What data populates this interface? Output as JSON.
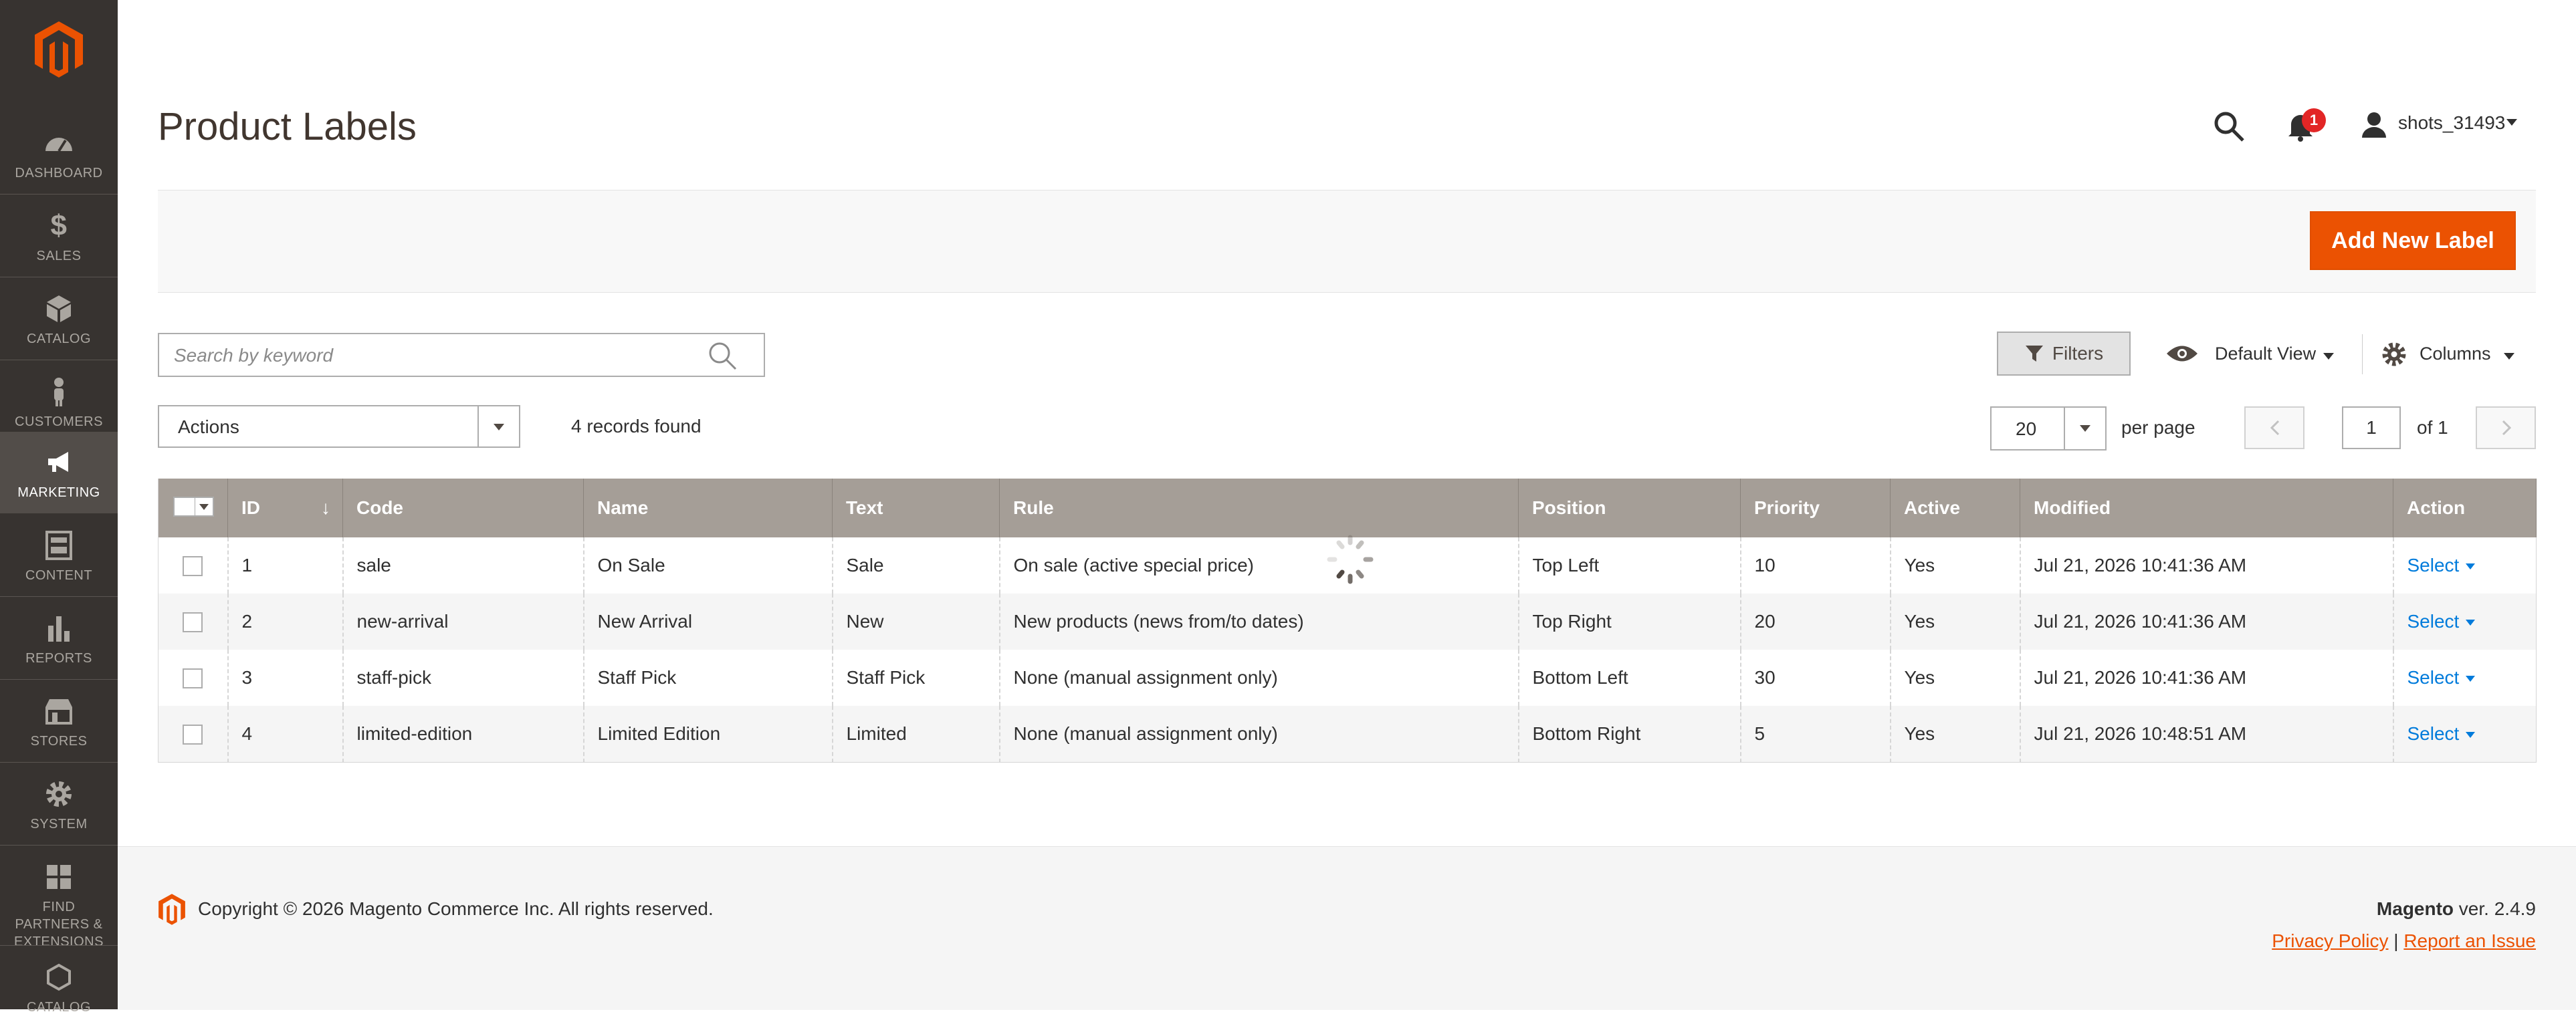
{
  "sidebar": {
    "items": [
      {
        "label": "DASHBOARD",
        "icon": "dashboard-icon"
      },
      {
        "label": "SALES",
        "icon": "dollar-icon"
      },
      {
        "label": "CATALOG",
        "icon": "cube-icon"
      },
      {
        "label": "CUSTOMERS",
        "icon": "person-icon"
      },
      {
        "label": "MARKETING",
        "icon": "megaphone-icon"
      },
      {
        "label": "CONTENT",
        "icon": "layout-icon"
      },
      {
        "label": "REPORTS",
        "icon": "bar-chart-icon"
      },
      {
        "label": "STORES",
        "icon": "store-icon"
      },
      {
        "label": "SYSTEM",
        "icon": "gear-icon"
      },
      {
        "label": "FIND PARTNERS & EXTENSIONS",
        "icon": "boxes-icon"
      },
      {
        "label": "CATALOG",
        "icon": "hexagon-icon"
      }
    ],
    "active": "MARKETING"
  },
  "header": {
    "title": "Product Labels",
    "notifications_count": "1",
    "username": "shots_31493"
  },
  "actionbar": {
    "add_label": "Add New Label"
  },
  "toolbar": {
    "search_placeholder": "Search by keyword",
    "filters_label": "Filters",
    "view_label": "Default View",
    "columns_label": "Columns",
    "actions_label": "Actions",
    "records_found": "4 records found",
    "per_page_value": "20",
    "per_page_label": "per page",
    "current_page": "1",
    "of_pages": "of 1"
  },
  "table": {
    "headers": {
      "id": "ID",
      "code": "Code",
      "name": "Name",
      "text": "Text",
      "rule": "Rule",
      "position": "Position",
      "priority": "Priority",
      "active": "Active",
      "modified": "Modified",
      "action": "Action"
    },
    "rows": [
      {
        "id": "1",
        "code": "sale",
        "name": "On Sale",
        "text": "Sale",
        "rule": "On sale (active special price)",
        "position": "Top Left",
        "priority": "10",
        "active": "Yes",
        "modified": "Jul 21, 2026 10:41:36 AM",
        "action": "Select"
      },
      {
        "id": "2",
        "code": "new-arrival",
        "name": "New Arrival",
        "text": "New",
        "rule": "New products (news from/to dates)",
        "position": "Top Right",
        "priority": "20",
        "active": "Yes",
        "modified": "Jul 21, 2026 10:41:36 AM",
        "action": "Select"
      },
      {
        "id": "3",
        "code": "staff-pick",
        "name": "Staff Pick",
        "text": "Staff Pick",
        "rule": "None (manual assignment only)",
        "position": "Bottom Left",
        "priority": "30",
        "active": "Yes",
        "modified": "Jul 21, 2026 10:41:36 AM",
        "action": "Select"
      },
      {
        "id": "4",
        "code": "limited-edition",
        "name": "Limited Edition",
        "text": "Limited",
        "rule": "None (manual assignment only)",
        "position": "Bottom Right",
        "priority": "5",
        "active": "Yes",
        "modified": "Jul 21, 2026 10:48:51 AM",
        "action": "Select"
      }
    ]
  },
  "footer": {
    "copyright": "Copyright © 2026 Magento Commerce Inc. All rights reserved.",
    "brand": "Magento",
    "version": " ver. 2.4.9",
    "privacy": "Privacy Policy",
    "separator": " | ",
    "report": "Report an Issue"
  },
  "colors": {
    "accent": "#eb5202",
    "sidebar_bg": "#373330",
    "table_header": "#a59e97",
    "link": "#007bdb"
  }
}
